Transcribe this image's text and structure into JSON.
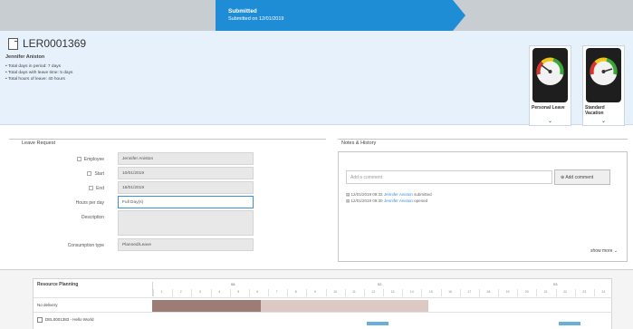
{
  "progress": {
    "steps": [
      {
        "title": "",
        "subtitle": ""
      },
      {
        "title": "Submitted",
        "subtitle": "Submitted on 12/01/2019"
      },
      {
        "title": "",
        "subtitle": ""
      }
    ]
  },
  "header": {
    "record_id": "LER0001369",
    "employee_name": "Jennifer Aniston",
    "stats": [
      "Total days in period: 7 days",
      "Total days with leave time: 5 days",
      "Total hours of leave: 40 hours"
    ],
    "gauges": [
      {
        "label": "Personal Leave",
        "level": 0.25
      },
      {
        "label": "Standard Vacation",
        "level": 0.7
      }
    ]
  },
  "leave_request": {
    "title": "Leave Request",
    "fields": [
      {
        "label": "Employee",
        "value": "Jennifer Aniston"
      },
      {
        "label": "Start",
        "value": "10/01/2019"
      },
      {
        "label": "End",
        "value": "16/01/2019"
      },
      {
        "label": "Hours per day",
        "value": "Full Day(s)"
      },
      {
        "label": "Description",
        "value": ""
      },
      {
        "label": "Consumption type",
        "value": "Planned/Leave"
      }
    ]
  },
  "notes": {
    "title": "Notes & History",
    "comment_placeholder": "Add a comment",
    "add_button": "Add comment",
    "history": [
      {
        "date": "12/01/2019 09:32",
        "who": "Jennifer Aniston",
        "action": "submitted"
      },
      {
        "date": "12/01/2019 09:30",
        "who": "Jennifer Aniston",
        "action": "opened"
      }
    ],
    "show_more": "show more"
  },
  "resource_planning": {
    "title": "Resource Planning",
    "months": [
      "08",
      "02",
      "03"
    ],
    "days": [
      "1",
      "2",
      "3",
      "4",
      "5",
      "6",
      "7",
      "8",
      "9",
      "10",
      "11",
      "12",
      "13",
      "14",
      "15",
      "16",
      "17",
      "18",
      "19",
      "20",
      "21",
      "22",
      "23",
      "24"
    ],
    "rows": [
      {
        "name": "No delivery"
      },
      {
        "name": "DEL0001383 - Hello World"
      }
    ]
  }
}
